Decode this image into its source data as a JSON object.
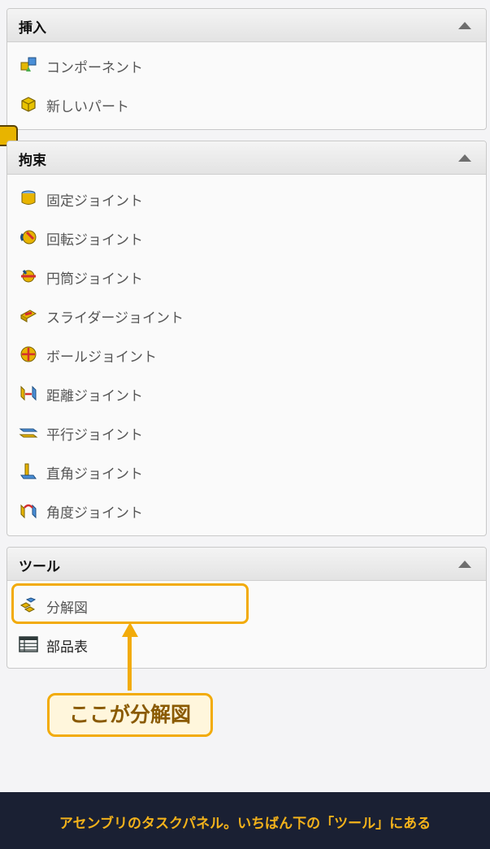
{
  "sections": [
    {
      "title": "挿入",
      "items": [
        {
          "label": "コンポーネント",
          "icon": "component-icon"
        },
        {
          "label": "新しいパート",
          "icon": "new-part-icon"
        }
      ]
    },
    {
      "title": "拘束",
      "items": [
        {
          "label": "固定ジョイント",
          "icon": "fixed-joint-icon"
        },
        {
          "label": "回転ジョイント",
          "icon": "revolute-joint-icon"
        },
        {
          "label": "円筒ジョイント",
          "icon": "cylindrical-joint-icon"
        },
        {
          "label": "スライダージョイント",
          "icon": "slider-joint-icon"
        },
        {
          "label": "ボールジョイント",
          "icon": "ball-joint-icon"
        },
        {
          "label": "距離ジョイント",
          "icon": "distance-joint-icon"
        },
        {
          "label": "平行ジョイント",
          "icon": "parallel-joint-icon"
        },
        {
          "label": "直角ジョイント",
          "icon": "perpendicular-joint-icon"
        },
        {
          "label": "角度ジョイント",
          "icon": "angle-joint-icon"
        }
      ]
    },
    {
      "title": "ツール",
      "items": [
        {
          "label": "分解図",
          "icon": "exploded-view-icon"
        },
        {
          "label": "部品表",
          "icon": "bill-of-materials-icon"
        }
      ]
    }
  ],
  "callout": {
    "text": "ここが分解図"
  },
  "footer": {
    "caption": "アセンブリのタスクパネル。いちばん下の「ツール」にある"
  },
  "colors": {
    "accent": "#f2ab0a",
    "footer_bg": "#1a2033",
    "footer_text": "#f3b21b"
  }
}
